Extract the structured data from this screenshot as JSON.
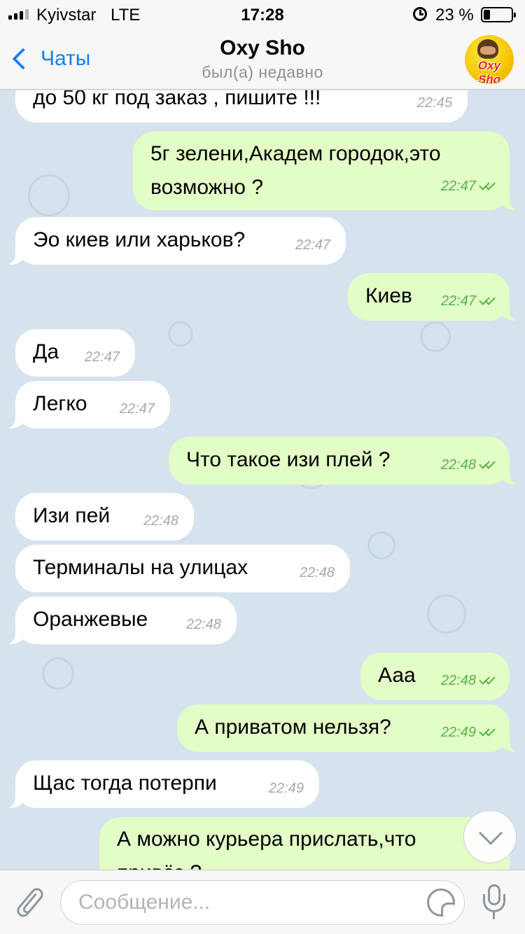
{
  "status_bar": {
    "carrier": "Kyivstar",
    "network": "LTE",
    "time": "17:28",
    "battery_percent": "23 %",
    "battery_level": 0.23,
    "icons": [
      "signal-icon",
      "alarm-icon",
      "battery-icon"
    ]
  },
  "header": {
    "back_label": "Чаты",
    "title": "Oxy Sho",
    "subtitle": "был(а) недавно",
    "avatar_text": "Oxy Sho"
  },
  "messages": [
    {
      "direction": "in",
      "text": "до 50 кг под заказ , пишите !!!",
      "time": "22:45",
      "partial": true
    },
    {
      "direction": "out",
      "text": "5г зелени,Академ городок,это\nвозможно ?",
      "time": "22:47",
      "read": true
    },
    {
      "direction": "in",
      "text": "Эо киев или харьков?",
      "time": "22:47"
    },
    {
      "direction": "out",
      "text": "Киев",
      "time": "22:47",
      "read": true
    },
    {
      "direction": "in",
      "text": "Да",
      "time": "22:47"
    },
    {
      "direction": "in",
      "text": "Легко",
      "time": "22:47"
    },
    {
      "direction": "out",
      "text": "Что такое изи плей ?",
      "time": "22:48",
      "read": true
    },
    {
      "direction": "in",
      "text": "Изи пей",
      "time": "22:48"
    },
    {
      "direction": "in",
      "text": "Терминалы на улицах",
      "time": "22:48"
    },
    {
      "direction": "in",
      "text": "Оранжевые",
      "time": "22:48"
    },
    {
      "direction": "out",
      "text": "Ааа",
      "time": "22:48",
      "read": true
    },
    {
      "direction": "out",
      "text": "А приватом нельзя?",
      "time": "22:49",
      "read": true
    },
    {
      "direction": "in",
      "text": "Щас тогда потерпи",
      "time": "22:49"
    },
    {
      "direction": "out",
      "text": "А можно курьера прислать,что\nпривёз ?",
      "time": "",
      "partial": true
    }
  ],
  "input": {
    "placeholder": "Сообщение..."
  },
  "colors": {
    "accent": "#157efb",
    "chat_background": "#d6e3ee",
    "incoming_bubble": "#ffffff",
    "outgoing_bubble": "#e2fdc6",
    "read_check": "#55b34a"
  }
}
